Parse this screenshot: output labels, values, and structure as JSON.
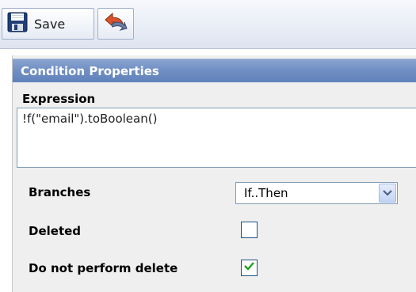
{
  "toolbar": {
    "save_label": "Save",
    "save_icon": "floppy-disk-icon",
    "undo_icon": "undo-arrow-icon"
  },
  "panel": {
    "title": "Condition Properties",
    "expression": {
      "label": "Expression",
      "value": "!f(\"email\").toBoolean()"
    },
    "branches": {
      "label": "Branches",
      "selected": "If..Then"
    },
    "deleted": {
      "label": "Deleted",
      "checked": false
    },
    "do_not_perform_delete": {
      "label": "Do not perform delete",
      "checked": true
    }
  },
  "colors": {
    "header_bg": "#6f8ec3",
    "panel_bg": "#efefef",
    "input_border": "#7f9db9",
    "check_green": "#21a121"
  }
}
